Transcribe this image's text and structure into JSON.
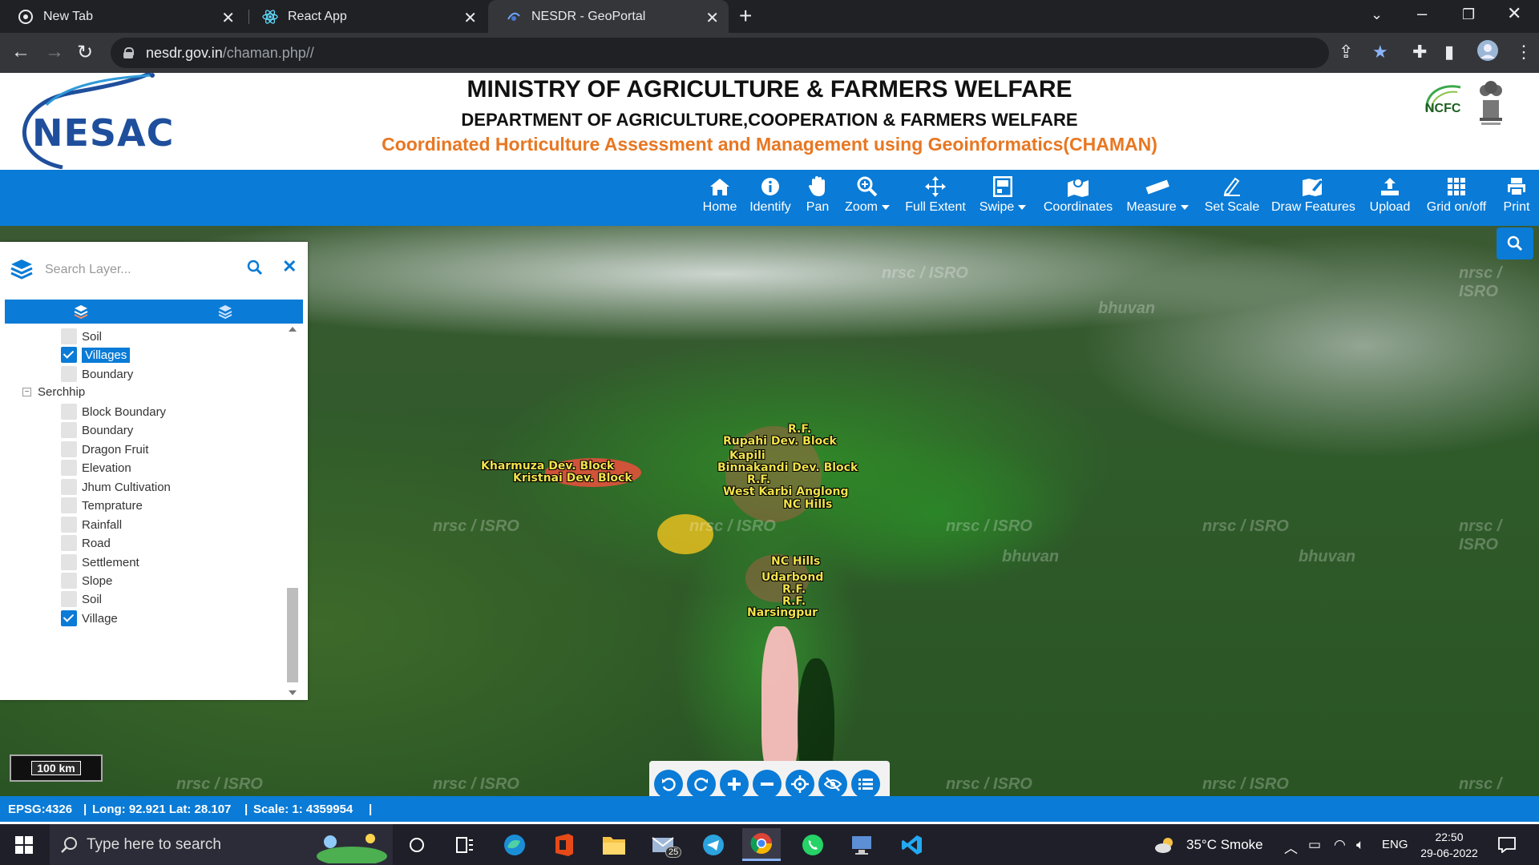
{
  "browser": {
    "tabs": [
      {
        "title": "New Tab"
      },
      {
        "title": "React App"
      },
      {
        "title": "NESDR - GeoPortal"
      }
    ],
    "url_domain": "nesdr.gov.in",
    "url_path": "/chaman.php//"
  },
  "header": {
    "logo_left": "NESAC",
    "title": "MINISTRY OF AGRICULTURE & FARMERS WELFARE",
    "subtitle": "DEPARTMENT OF AGRICULTURE,COOPERATION & FARMERS WELFARE",
    "project": "Coordinated Horticulture Assessment and Management using Geoinformatics(CHAMAN)",
    "logo_right": "NCFC"
  },
  "toolbar": {
    "items": [
      {
        "label": "Home",
        "icon": "home-icon"
      },
      {
        "label": "Identify",
        "icon": "info-icon"
      },
      {
        "label": "Pan",
        "icon": "hand-icon"
      },
      {
        "label": "Zoom",
        "icon": "zoom-icon"
      },
      {
        "label": "Full Extent",
        "icon": "move-icon"
      },
      {
        "label": "Swipe",
        "icon": "swipe-icon"
      },
      {
        "label": "Coordinates",
        "icon": "map-marker-icon"
      },
      {
        "label": "Measure",
        "icon": "ruler-icon"
      },
      {
        "label": "Set Scale",
        "icon": "pencil-icon"
      },
      {
        "label": "Draw Features",
        "icon": "draw-map-icon"
      },
      {
        "label": "Upload",
        "icon": "upload-icon"
      },
      {
        "label": "Grid on/off",
        "icon": "grid-icon"
      },
      {
        "label": "Print",
        "icon": "print-icon"
      }
    ]
  },
  "layer_panel": {
    "search_placeholder": "Search Layer...",
    "tree": [
      {
        "label": "Soil",
        "checked": false
      },
      {
        "label": "Villages",
        "checked": true
      },
      {
        "label": "Boundary",
        "checked": false
      },
      {
        "label": "Serchhip",
        "group": true
      },
      {
        "label": "Block Boundary",
        "checked": false
      },
      {
        "label": "Boundary",
        "checked": false
      },
      {
        "label": "Dragon Fruit",
        "checked": false
      },
      {
        "label": "Elevation",
        "checked": false
      },
      {
        "label": "Jhum Cultivation",
        "checked": false
      },
      {
        "label": "Temprature",
        "checked": false
      },
      {
        "label": "Rainfall",
        "checked": false
      },
      {
        "label": "Road",
        "checked": false
      },
      {
        "label": "Settlement",
        "checked": false
      },
      {
        "label": "Slope",
        "checked": false
      },
      {
        "label": "Soil",
        "checked": false
      },
      {
        "label": "Village",
        "checked": true
      }
    ]
  },
  "map": {
    "watermarks": [
      "nrsc / ISRO",
      "bhuvan"
    ],
    "labels": [
      "Kharmuza Dev. Block",
      "Kristnai Dev. Block",
      "R.F.",
      "Rupahi Dev. Block",
      "Kapili",
      "Binnakandi Dev. Block",
      "R.F.",
      "West Karbi Anglong",
      "NC Hills",
      "NC Hills",
      "Udarbond",
      "R.F.",
      "R.F.",
      "Narsingpur"
    ],
    "scale_bar": "100 km"
  },
  "statusbar": {
    "epsg": "EPSG:4326",
    "coords": "Long: 92.921 Lat: 28.107",
    "scale": "Scale: 1: 4359954"
  },
  "taskbar": {
    "search_placeholder": "Type here to search",
    "mail_badge": "25",
    "weather": "35°C  Smoke",
    "lang": "ENG",
    "time": "22:50",
    "date": "29-06-2022"
  }
}
